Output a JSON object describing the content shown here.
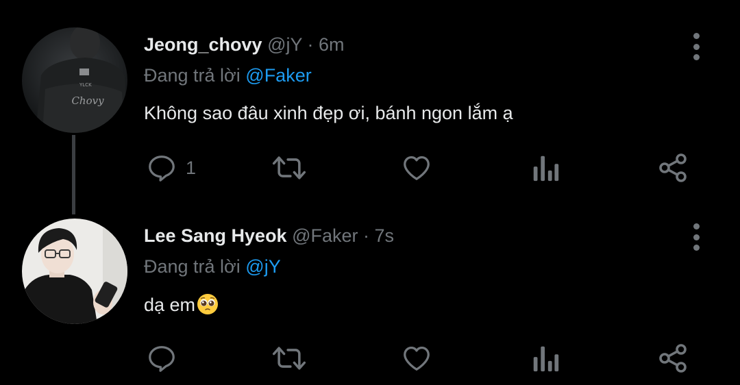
{
  "tweets": [
    {
      "author": "Jeong_chovy",
      "handle": "@jY",
      "time": "6m",
      "reply_prefix": "Đang trả lời",
      "reply_to": "@Faker",
      "text": "Không sao đâu xinh đẹp ơi, bánh ngon lắm ạ",
      "reply_count": "1",
      "jersey_text": "Chovy"
    },
    {
      "author": "Lee Sang Hyeok",
      "handle": "@Faker",
      "time": "7s",
      "reply_prefix": "Đang trả lời",
      "reply_to": "@jY",
      "text": "dạ em",
      "reply_count": ""
    }
  ],
  "separator": " · ",
  "colors": {
    "background": "#000000",
    "text": "#e7e9ea",
    "muted": "#71767b",
    "mention": "#1d9bf0"
  },
  "icons": [
    "reply-icon",
    "retweet-icon",
    "like-icon",
    "views-icon",
    "share-icon",
    "more-icon",
    "pleading-face-emoji"
  ]
}
